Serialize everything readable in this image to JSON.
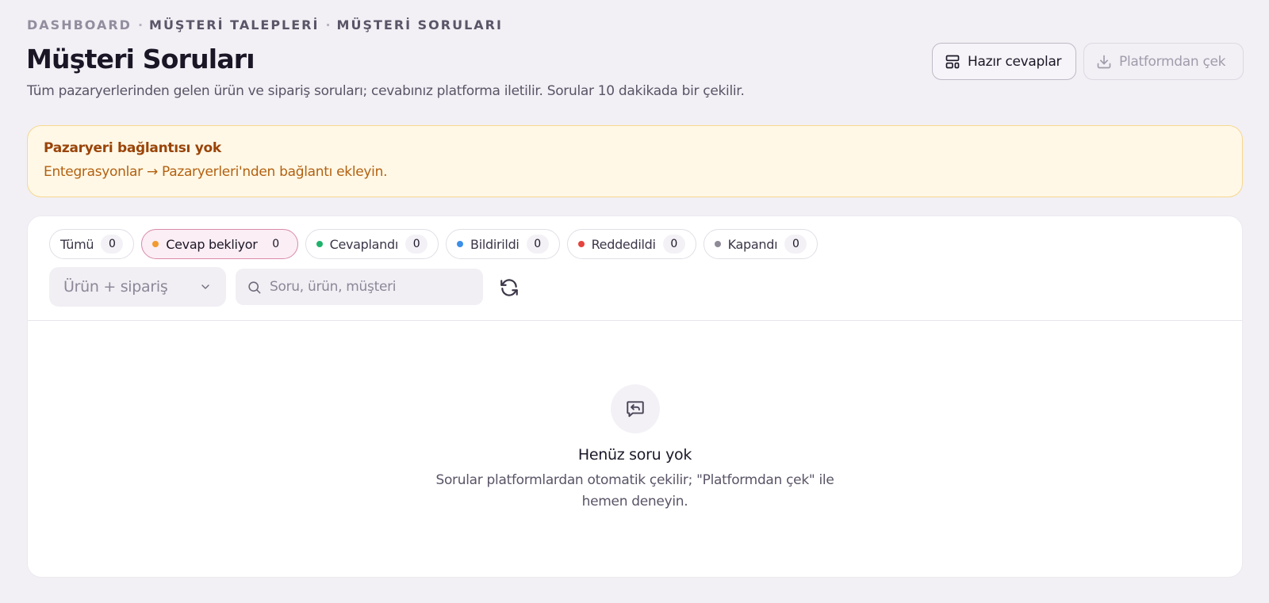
{
  "breadcrumb": {
    "items": [
      "DASHBOARD",
      "MÜŞTERİ TALEPLERİ",
      "MÜŞTERİ SORULARI"
    ],
    "separator": "·"
  },
  "page": {
    "title": "Müşteri Soruları",
    "subtitle": "Tüm pazaryerlerinden gelen ürün ve sipariş soruları; cevabınız platforma iletilir. Sorular 10 dakikada bir çekilir."
  },
  "header_buttons": {
    "templates_label": "Hazır cevaplar",
    "templates_icon": "layout-template-icon",
    "pull_label": "Platformdan çek",
    "pull_icon": "download-icon"
  },
  "alert": {
    "title": "Pazaryeri bağlantısı yok",
    "body": "Entegrasyonlar → Pazaryerleri'nden bağlantı ekleyin."
  },
  "filters": {
    "chips": [
      {
        "label": "Tümü",
        "count": "0",
        "dot_color": null,
        "active": false
      },
      {
        "label": "Cevap bekliyor",
        "count": "0",
        "dot_color": "#f29a2e",
        "active": true
      },
      {
        "label": "Cevaplandı",
        "count": "0",
        "dot_color": "#1fb26b",
        "active": false
      },
      {
        "label": "Bildirildi",
        "count": "0",
        "dot_color": "#3b8fe8",
        "active": false
      },
      {
        "label": "Reddedildi",
        "count": "0",
        "dot_color": "#e5443c",
        "active": false
      },
      {
        "label": "Kapandı",
        "count": "0",
        "dot_color": "#8e8a96",
        "active": false
      }
    ],
    "type_select": {
      "value": "Ürün + sipariş",
      "icon": "chevron-down-icon"
    },
    "search": {
      "placeholder": "Soru, ürün, müşteri",
      "value": "",
      "icon": "search-icon"
    },
    "refresh_icon": "refresh-icon"
  },
  "empty_state": {
    "icon": "message-reply-icon",
    "title": "Henüz soru yok",
    "description": "Sorular platformlardan otomatik çekilir; \"Platformdan çek\" ile hemen deneyin."
  }
}
